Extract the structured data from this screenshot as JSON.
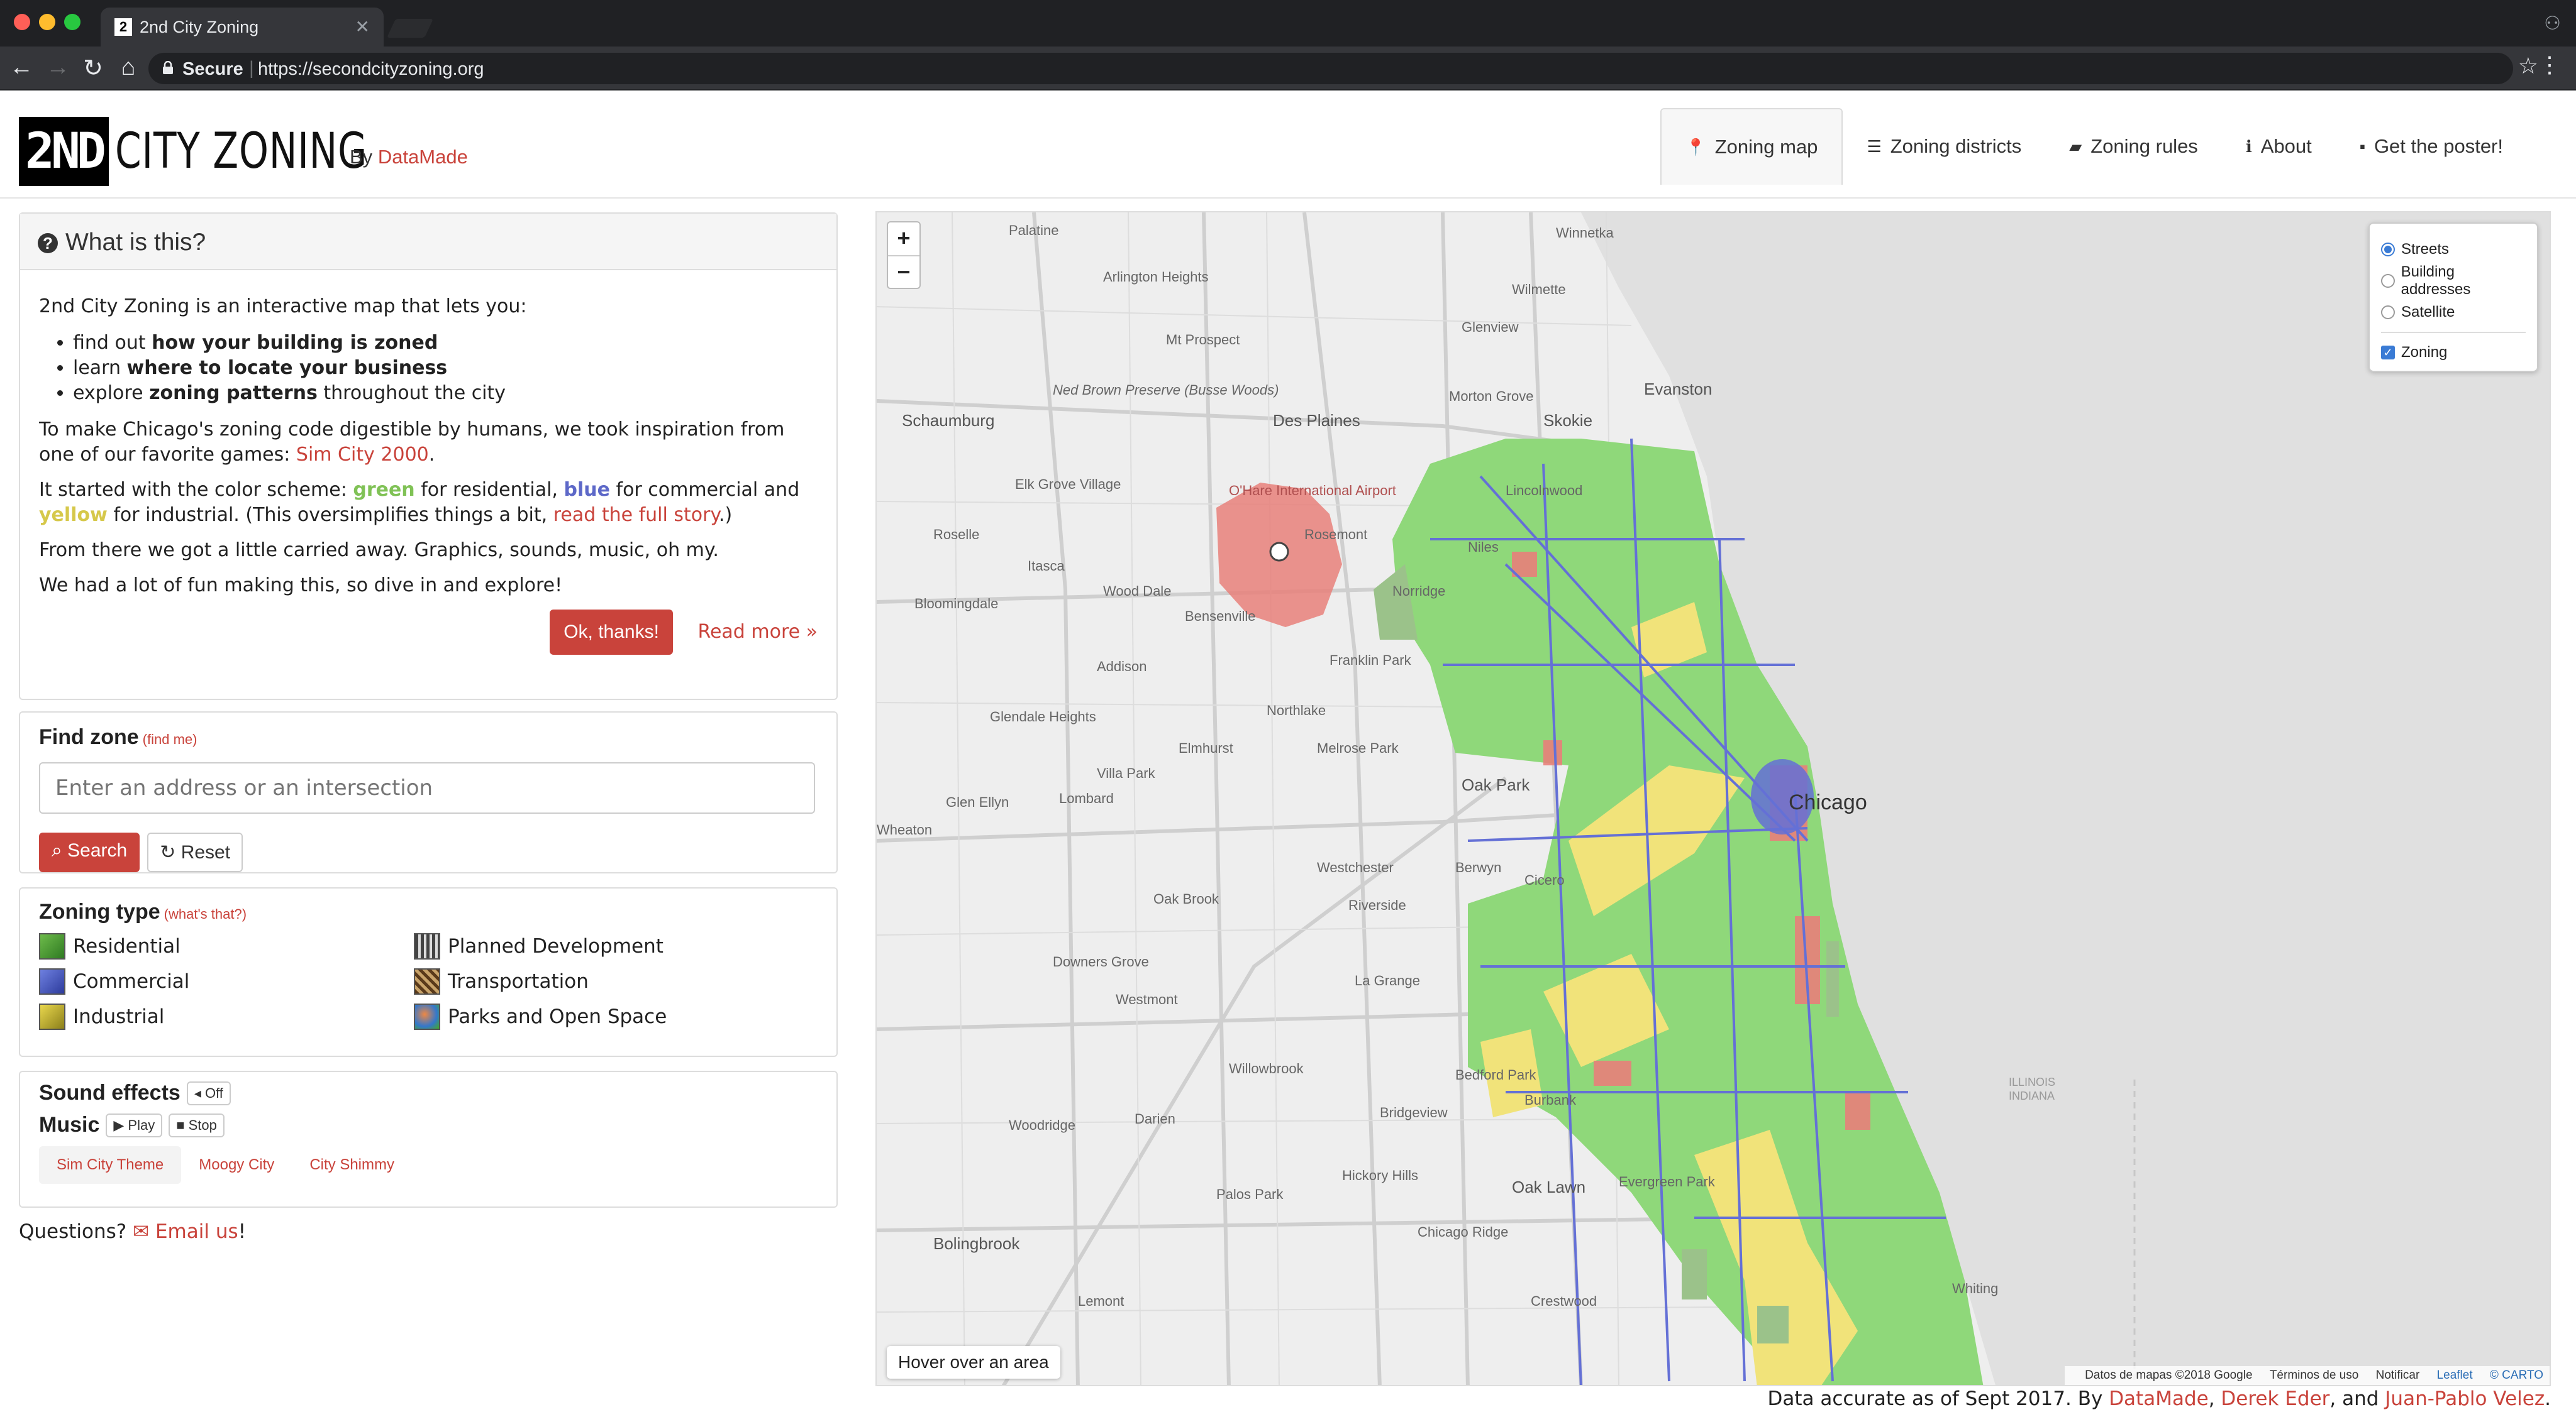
{
  "browser": {
    "tab_title": "2nd City Zoning",
    "tab_favicon": "2",
    "secure_label": "Secure",
    "url": "https://secondcityzoning.org"
  },
  "header": {
    "logo_box": "2ND",
    "logo_text": "CITY ZONING",
    "by": "By",
    "by_link": "DataMade",
    "nav": [
      {
        "label": "Zoning map",
        "icon": "map-marker-icon"
      },
      {
        "label": "Zoning districts",
        "icon": "list-icon"
      },
      {
        "label": "Zoning rules",
        "icon": "book-icon"
      },
      {
        "label": "About",
        "icon": "info-icon"
      },
      {
        "label": "Get the poster!",
        "icon": "poster-icon"
      }
    ]
  },
  "about": {
    "title": "What is this?",
    "intro": "2nd City Zoning is an interactive map that lets you:",
    "bullets": [
      {
        "pre": "find out ",
        "bold": "how your building is zoned",
        "post": ""
      },
      {
        "pre": "learn ",
        "bold": "where to locate your business",
        "post": ""
      },
      {
        "pre": "explore ",
        "bold": "zoning patterns",
        "post": " throughout the city"
      }
    ],
    "p2_pre": "To make Chicago's zoning code digestible by humans, we took inspiration from one of our favorite games: ",
    "p2_link": "Sim City 2000",
    "p2_post": ".",
    "p3_a": "It started with the color scheme: ",
    "p3_green": "green",
    "p3_b": " for residential, ",
    "p3_blue": "blue",
    "p3_c": " for commercial and ",
    "p3_yellow": "yellow",
    "p3_d": " for industrial. (This oversimplifies things a bit, ",
    "p3_link": "read the full story",
    "p3_e": ".)",
    "p4": "From there we got a little carried away. Graphics, sounds, music, oh my.",
    "p5": "We had a lot of fun making this, so dive in and explore!",
    "ok_button": "Ok, thanks!",
    "read_more": "Read more »"
  },
  "find_zone": {
    "title": "Find zone",
    "find_me": "(find me)",
    "placeholder": "Enter an address or an intersection",
    "search_label": "Search",
    "reset_label": "Reset"
  },
  "zoning_type": {
    "title": "Zoning type",
    "whats_that": "(what's that?)",
    "items": [
      "Residential",
      "Planned Development",
      "Commercial",
      "Transportation",
      "Industrial",
      "Parks and Open Space"
    ]
  },
  "sound": {
    "effects_label": "Sound effects",
    "effects_btn": "Off",
    "music_label": "Music",
    "play": "Play",
    "stop": "Stop",
    "tracks": [
      "Sim City Theme",
      "Moogy City",
      "City Shimmy"
    ]
  },
  "questions": {
    "pre": "Questions? ",
    "link": "Email us",
    "post": "!"
  },
  "map": {
    "zoom_in": "+",
    "zoom_out": "−",
    "layers": [
      "Streets",
      "Building addresses",
      "Satellite"
    ],
    "selected_layer": "Streets",
    "overlay": "Zoning",
    "overlay_checked": true,
    "hover_text": "Hover over an area",
    "city_label": "Chicago",
    "place_labels": [
      "Palatine",
      "Winnetka",
      "Arlington Heights",
      "Mt Prospect",
      "Glenview",
      "Wilmette",
      "Evanston",
      "Skokie",
      "Schaumburg",
      "Ned Brown Preserve (Busse Woods)",
      "Des Plaines",
      "Morton Grove",
      "Elk Grove Village",
      "O'Hare International Airport",
      "Rosemont",
      "Niles",
      "Lincolnwood",
      "Roselle",
      "Itasca",
      "Wood Dale",
      "Norridge",
      "Bloomingdale",
      "Bensenville",
      "Addison",
      "Franklin Park",
      "Glendale Heights",
      "Northlake",
      "Elmhurst",
      "Melrose Park",
      "Villa Park",
      "Lombard",
      "Oak Park",
      "Glen Ellyn",
      "Wheaton",
      "Westchester",
      "Berwyn",
      "Cicero",
      "Oak Brook",
      "Riverside",
      "Downers Grove",
      "Westmont",
      "La Grange",
      "Bedford Park",
      "Burbank",
      "Willowbrook",
      "Darien",
      "Bridgeview",
      "Woodridge",
      "Hickory Hills",
      "Oak Lawn",
      "Evergreen Park",
      "Palos Park",
      "Chicago Ridge",
      "Bolingbrook",
      "Lemont",
      "Crestwood",
      "Whiting",
      "ILLINOIS",
      "INDIANA"
    ],
    "attribution": [
      "Datos de mapas ©2018 Google",
      "Términos de uso",
      "Notificar",
      "Leaflet",
      "© CARTO"
    ],
    "legend_colors": {
      "residential": "#8fd87a",
      "commercial": "#6470d6",
      "industrial": "#f1e37a",
      "planned_development": "#e8807a",
      "parks": "#9bc28a"
    }
  },
  "footer": {
    "pre": "Data accurate as of Sept 2017. By ",
    "a1": "DataMade",
    "sep1": ", ",
    "a2": "Derek Eder",
    "sep2": ", and ",
    "a3": "Juan-Pablo Velez",
    "post": "."
  }
}
